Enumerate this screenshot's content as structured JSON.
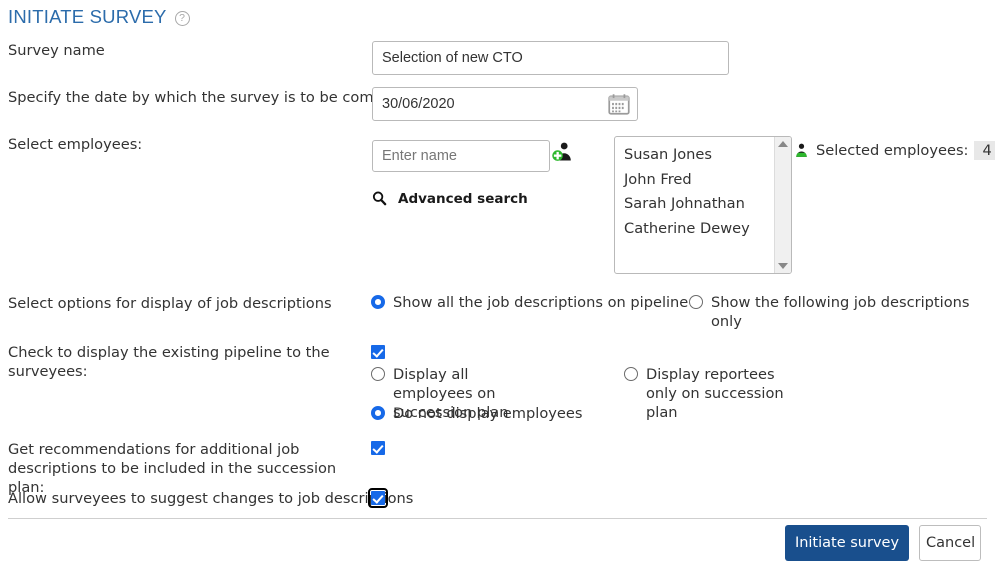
{
  "header": {
    "title": "INITIATE SURVEY",
    "help_icon": "question-mark-circle-icon",
    "help_glyph": "?",
    "title_color": "#2c6cab"
  },
  "fields": {
    "survey_name": {
      "label": "Survey name",
      "value": "Selection of new CTO",
      "placeholder": ""
    },
    "completion_date": {
      "label": "Specify the date by which the survey is to be completed",
      "value": "30/06/2020",
      "placeholder": "",
      "icon": "calendar-icon"
    },
    "select_employees": {
      "label": "Select employees:",
      "name_input_placeholder": "Enter name",
      "name_input_value": "",
      "add_person_icon": "add-person-icon",
      "advanced_search_label": "Advanced search",
      "advanced_search_icon": "search-icon",
      "selected_list": [
        "Susan Jones",
        "John Fred",
        "Sarah Johnathan",
        "Catherine Dewey"
      ],
      "selected_count_icon": "person-icon",
      "selected_count_label": "Selected employees:",
      "selected_count_value": "4",
      "scrollbar_up_icon": "scroll-up-arrow-icon",
      "scrollbar_down_icon": "scroll-down-arrow-icon"
    }
  },
  "job_description_display": {
    "label": "Select options for display of job descriptions",
    "options": [
      {
        "label": "Show all the job descriptions on pipeline",
        "selected": true
      },
      {
        "label": "Show the following job descriptions only",
        "selected": false
      }
    ]
  },
  "pipeline_display": {
    "label": "Check to display the existing pipeline to the surveyees:",
    "checkbox_checked": true,
    "options": [
      {
        "label": "Display all employees on succession plan",
        "selected": false
      },
      {
        "label": "Display reportees only on succession plan",
        "selected": false
      },
      {
        "label": "Do not display employees",
        "selected": true
      }
    ]
  },
  "recommendations": {
    "label": "Get recommendations for additional job descriptions to be included in the succession plan:",
    "checkbox_checked": true
  },
  "suggest_changes": {
    "label": "Allow surveyees to suggest changes to job descriptions",
    "checkbox_checked": true,
    "focused": true
  },
  "footer": {
    "primary_button": "Initiate survey",
    "secondary_button": "Cancel",
    "primary_color": "#194f8d"
  }
}
